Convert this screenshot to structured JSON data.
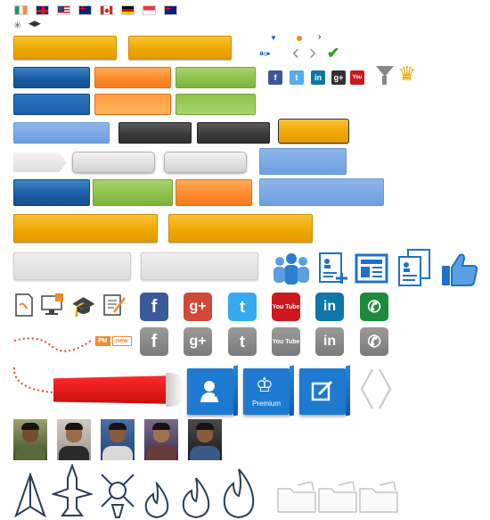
{
  "flags": [
    "ireland",
    "united-kingdom",
    "united-states",
    "australia",
    "canada",
    "germany",
    "singapore",
    "new-zealand"
  ],
  "social_small": [
    {
      "name": "facebook",
      "glyph": "f",
      "color": "#3b5998"
    },
    {
      "name": "twitter",
      "glyph": "t",
      "color": "#55acee"
    },
    {
      "name": "linkedin",
      "glyph": "in",
      "color": "#0e76a8"
    },
    {
      "name": "google-plus",
      "glyph": "g+",
      "color": "#333333"
    },
    {
      "name": "youtube",
      "glyph": "You",
      "color": "#cc181e"
    }
  ],
  "social_large": [
    {
      "name": "facebook",
      "glyph": "f",
      "color": "#3b5998"
    },
    {
      "name": "google-plus",
      "glyph": "g+",
      "color": "#d34836"
    },
    {
      "name": "twitter",
      "glyph": "t",
      "color": "#33aaf0"
    },
    {
      "name": "youtube",
      "glyph": "You Tube",
      "color": "#cc181e"
    },
    {
      "name": "linkedin",
      "glyph": "in",
      "color": "#0e76a8"
    },
    {
      "name": "whatsapp",
      "glyph": "✆",
      "color": "#1d8a3c"
    }
  ],
  "badges": {
    "pm": "PM",
    "new": "new"
  },
  "stickers": {
    "premium": "Premium"
  },
  "colors": {
    "yellow": "#f0a800",
    "blue": "#1a5ea6",
    "orange": "#ff8a2e",
    "green": "#8ec24c",
    "light_blue": "#6d9ee0",
    "dark": "#3b3b3b"
  }
}
